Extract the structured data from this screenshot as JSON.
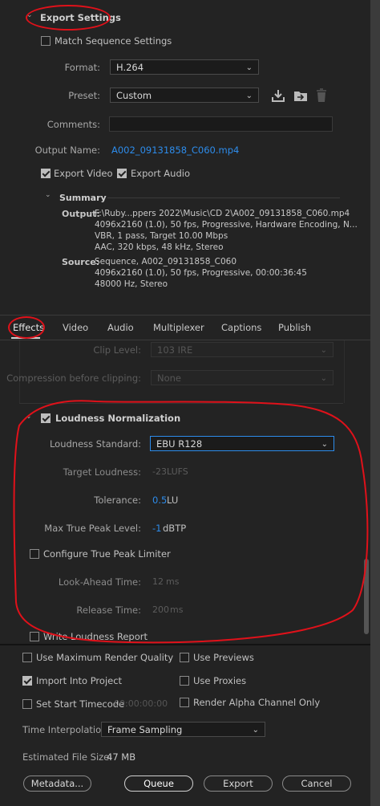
{
  "export_settings": {
    "title": "Export Settings",
    "match_sequence_label": "Match Sequence Settings",
    "format_label": "Format:",
    "format_value": "H.264",
    "preset_label": "Preset:",
    "preset_value": "Custom",
    "comments_label": "Comments:",
    "comments_value": "",
    "output_name_label": "Output Name:",
    "output_name_value": "A002_09131858_C060.mp4",
    "export_video_label": "Export Video",
    "export_audio_label": "Export Audio"
  },
  "summary": {
    "title": "Summary",
    "output_label": "Output:",
    "output_lines": [
      "F:\\Ruby...ppers 2022\\Music\\CD 2\\A002_09131858_C060.mp4",
      "4096x2160 (1.0), 50 fps, Progressive, Hardware Encoding, N...",
      "VBR, 1 pass, Target 10.00 Mbps",
      "AAC, 320 kbps, 48 kHz, Stereo"
    ],
    "source_label": "Source:",
    "source_lines": [
      "Sequence, A002_09131858_C060",
      "4096x2160 (1.0), 50 fps, Progressive, 00:00:36:45",
      "48000 Hz, Stereo"
    ]
  },
  "tabs": [
    "Effects",
    "Video",
    "Audio",
    "Multiplexer",
    "Captions",
    "Publish"
  ],
  "effects": {
    "clip_level_label": "Clip Level:",
    "clip_level_value": "103 IRE",
    "compression_label": "Compression before clipping:",
    "compression_value": "None"
  },
  "loudness": {
    "title": "Loudness Normalization",
    "standard_label": "Loudness Standard:",
    "standard_value": "EBU R128",
    "target_label": "Target Loudness:",
    "target_value": "-23",
    "target_unit": "LUFS",
    "tolerance_label": "Tolerance:",
    "tolerance_value": "0.5",
    "tolerance_unit": "LU",
    "peak_label": "Max True Peak Level:",
    "peak_value": "-1",
    "peak_unit": "dBTP",
    "configure_label": "Configure True Peak Limiter",
    "lookahead_label": "Look-Ahead Time:",
    "lookahead_value": "12",
    "lookahead_unit": "ms",
    "release_label": "Release Time:",
    "release_value": "200",
    "release_unit": "ms",
    "write_report_label": "Write Loudness Report"
  },
  "bottom": {
    "max_render_label": "Use Maximum Render Quality",
    "use_previews_label": "Use Previews",
    "import_project_label": "Import Into Project",
    "use_proxies_label": "Use Proxies",
    "set_start_tc_label": "Set Start Timecode",
    "start_tc_value": "00:00:00:00",
    "render_alpha_label": "Render Alpha Channel Only",
    "time_interp_label": "Time Interpolation:",
    "time_interp_value": "Frame Sampling",
    "file_size_label": "Estimated File Size:",
    "file_size_value": "47 MB",
    "metadata_btn": "Metadata...",
    "queue_btn": "Queue",
    "export_btn": "Export",
    "cancel_btn": "Cancel"
  },
  "colors": {
    "link": "#2d8ceb",
    "annotation": "#e0111a",
    "bg": "#232323"
  }
}
